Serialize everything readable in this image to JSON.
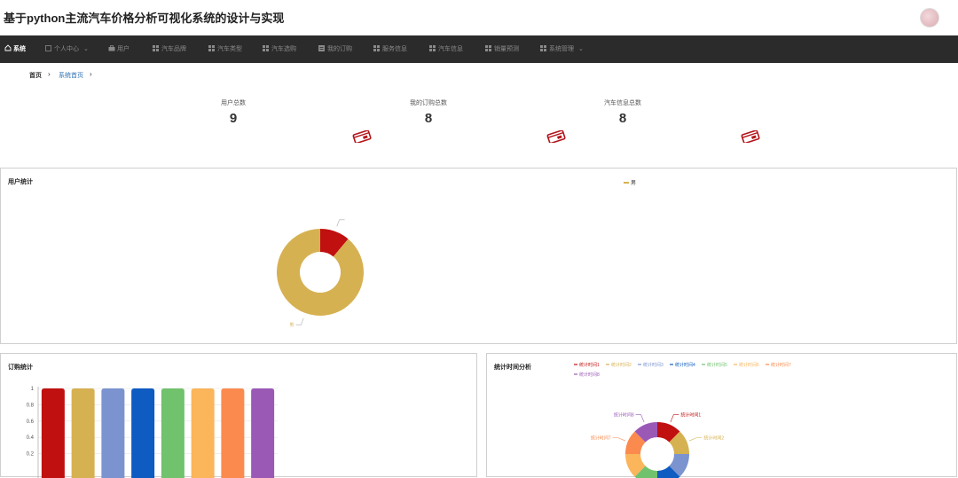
{
  "app": {
    "title": "基于python主流汽车价格分析可视化系统的设计与实现"
  },
  "nav": [
    {
      "label": "系统",
      "icon": "home-icon",
      "active": true
    },
    {
      "label": "个人中心",
      "icon": "grid-icon",
      "dropdown": true
    },
    {
      "label": "用户",
      "icon": "user-icon"
    },
    {
      "label": "汽车品牌",
      "icon": "grid-icon"
    },
    {
      "label": "汽车类型",
      "icon": "grid-icon"
    },
    {
      "label": "汽车选购",
      "icon": "grid-icon"
    },
    {
      "label": "我的订购",
      "icon": "list-icon"
    },
    {
      "label": "服务信息",
      "icon": "grid-icon"
    },
    {
      "label": "汽车信息",
      "icon": "grid-icon"
    },
    {
      "label": "销量预测",
      "icon": "grid-icon"
    },
    {
      "label": "系统管理",
      "icon": "grid-icon",
      "dropdown": true
    }
  ],
  "breadcrumb": {
    "home": "首页",
    "current": "系统首页"
  },
  "stats": [
    {
      "label": "用户总数",
      "value": "9"
    },
    {
      "label": "我的订购总数",
      "value": "8"
    },
    {
      "label": "汽车信息总数",
      "value": "8"
    }
  ],
  "panels": {
    "user": {
      "title": "用户统计",
      "legend_label": "男"
    },
    "order": {
      "title": "订购统计"
    },
    "time": {
      "title": "统计时间分析"
    }
  },
  "chart_data": [
    {
      "type": "pie",
      "title": "用户统计",
      "donut": true,
      "slices": [
        {
          "name": "男",
          "value": 8,
          "color": "#d6b152"
        },
        {
          "name": "",
          "value": 1,
          "color": "#c01010"
        }
      ]
    },
    {
      "type": "bar",
      "title": "订购统计",
      "ylim": [
        0,
        1
      ],
      "yticks": [
        "1",
        "0.8",
        "0.6",
        "0.4",
        "0.2"
      ],
      "values": [
        1,
        1,
        1,
        1,
        1,
        1,
        1,
        1
      ],
      "colors": [
        "#c01010",
        "#d6b152",
        "#7b93cf",
        "#0e5bc2",
        "#71c26d",
        "#fbb55b",
        "#fb8a4e",
        "#9b59b6"
      ]
    },
    {
      "type": "pie",
      "title": "统计时间分析",
      "donut": true,
      "legend": [
        "统计时间1",
        "统计时间2",
        "统计时间3",
        "统计时间4",
        "统计时间5",
        "统计时间6",
        "统计时间7",
        "统计时间8"
      ],
      "colors": [
        "#c01010",
        "#d6b152",
        "#7b93cf",
        "#0e5bc2",
        "#71c26d",
        "#fbb55b",
        "#fb8a4e",
        "#9b59b6"
      ],
      "values": [
        1,
        1,
        1,
        1,
        1,
        1,
        1,
        1
      ]
    }
  ]
}
